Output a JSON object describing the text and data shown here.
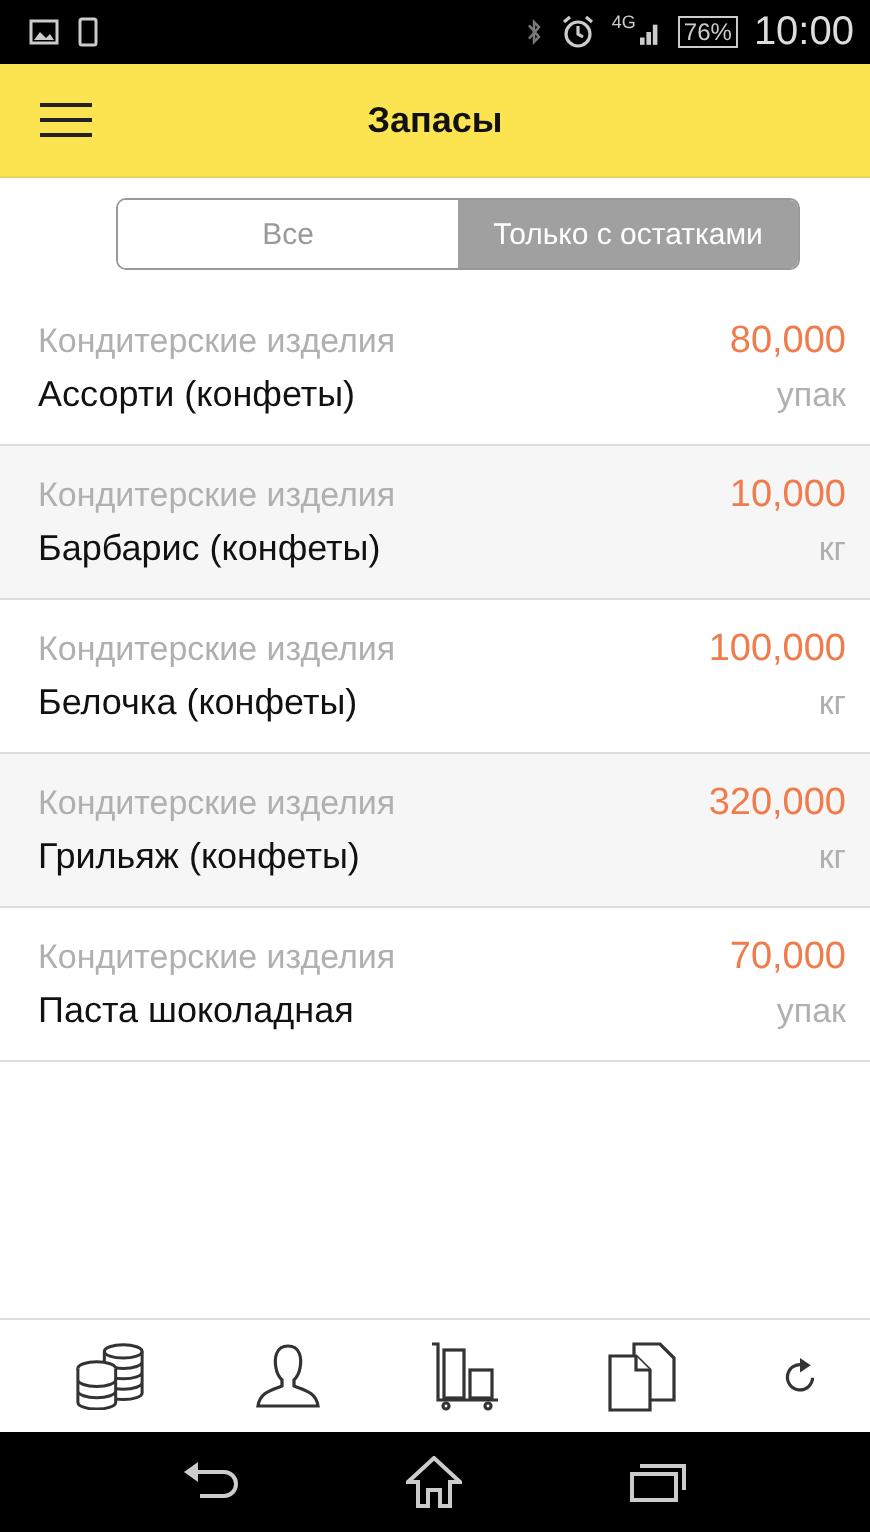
{
  "status_bar": {
    "network": "4G",
    "battery": "76%",
    "time": "10:00"
  },
  "header": {
    "title": "Запасы"
  },
  "filter_tabs": [
    {
      "label": "Все",
      "selected": false
    },
    {
      "label": "Только с остатками",
      "selected": true
    }
  ],
  "items": [
    {
      "category": "Кондитерские изделия",
      "name": "Ассорти (конфеты)",
      "quantity": "80,000",
      "unit": "упак"
    },
    {
      "category": "Кондитерские изделия",
      "name": "Барбарис (конфеты)",
      "quantity": "10,000",
      "unit": "кг"
    },
    {
      "category": "Кондитерские изделия",
      "name": "Белочка (конфеты)",
      "quantity": "100,000",
      "unit": "кг"
    },
    {
      "category": "Кондитерские изделия",
      "name": "Грильяж (конфеты)",
      "quantity": "320,000",
      "unit": "кг"
    },
    {
      "category": "Кондитерские изделия",
      "name": "Паста шоколадная",
      "quantity": "70,000",
      "unit": "упак"
    }
  ]
}
